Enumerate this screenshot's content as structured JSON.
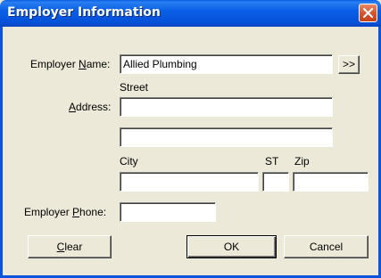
{
  "window": {
    "title": "Employer Information"
  },
  "form": {
    "employer_name_label_pre": "Employer ",
    "employer_name_label_u": "N",
    "employer_name_label_post": "ame:",
    "employer_name_value": "Allied Plumbing",
    "lookup_button_label": ">>",
    "street_label": "Street",
    "address_label_u": "A",
    "address_label_post": "ddress:",
    "address_line1_value": "",
    "address_line2_value": "",
    "city_label": "City",
    "state_label": "ST",
    "zip_label": "Zip",
    "city_value": "",
    "state_value": "",
    "zip_value": "",
    "employer_phone_label_pre": "Employer ",
    "employer_phone_label_u": "P",
    "employer_phone_label_post": "hone:",
    "employer_phone_value": ""
  },
  "buttons": {
    "clear_u": "C",
    "clear_post": "lear",
    "ok_label": "OK",
    "cancel_label": "Cancel"
  },
  "icons": {
    "close": "close-icon"
  }
}
